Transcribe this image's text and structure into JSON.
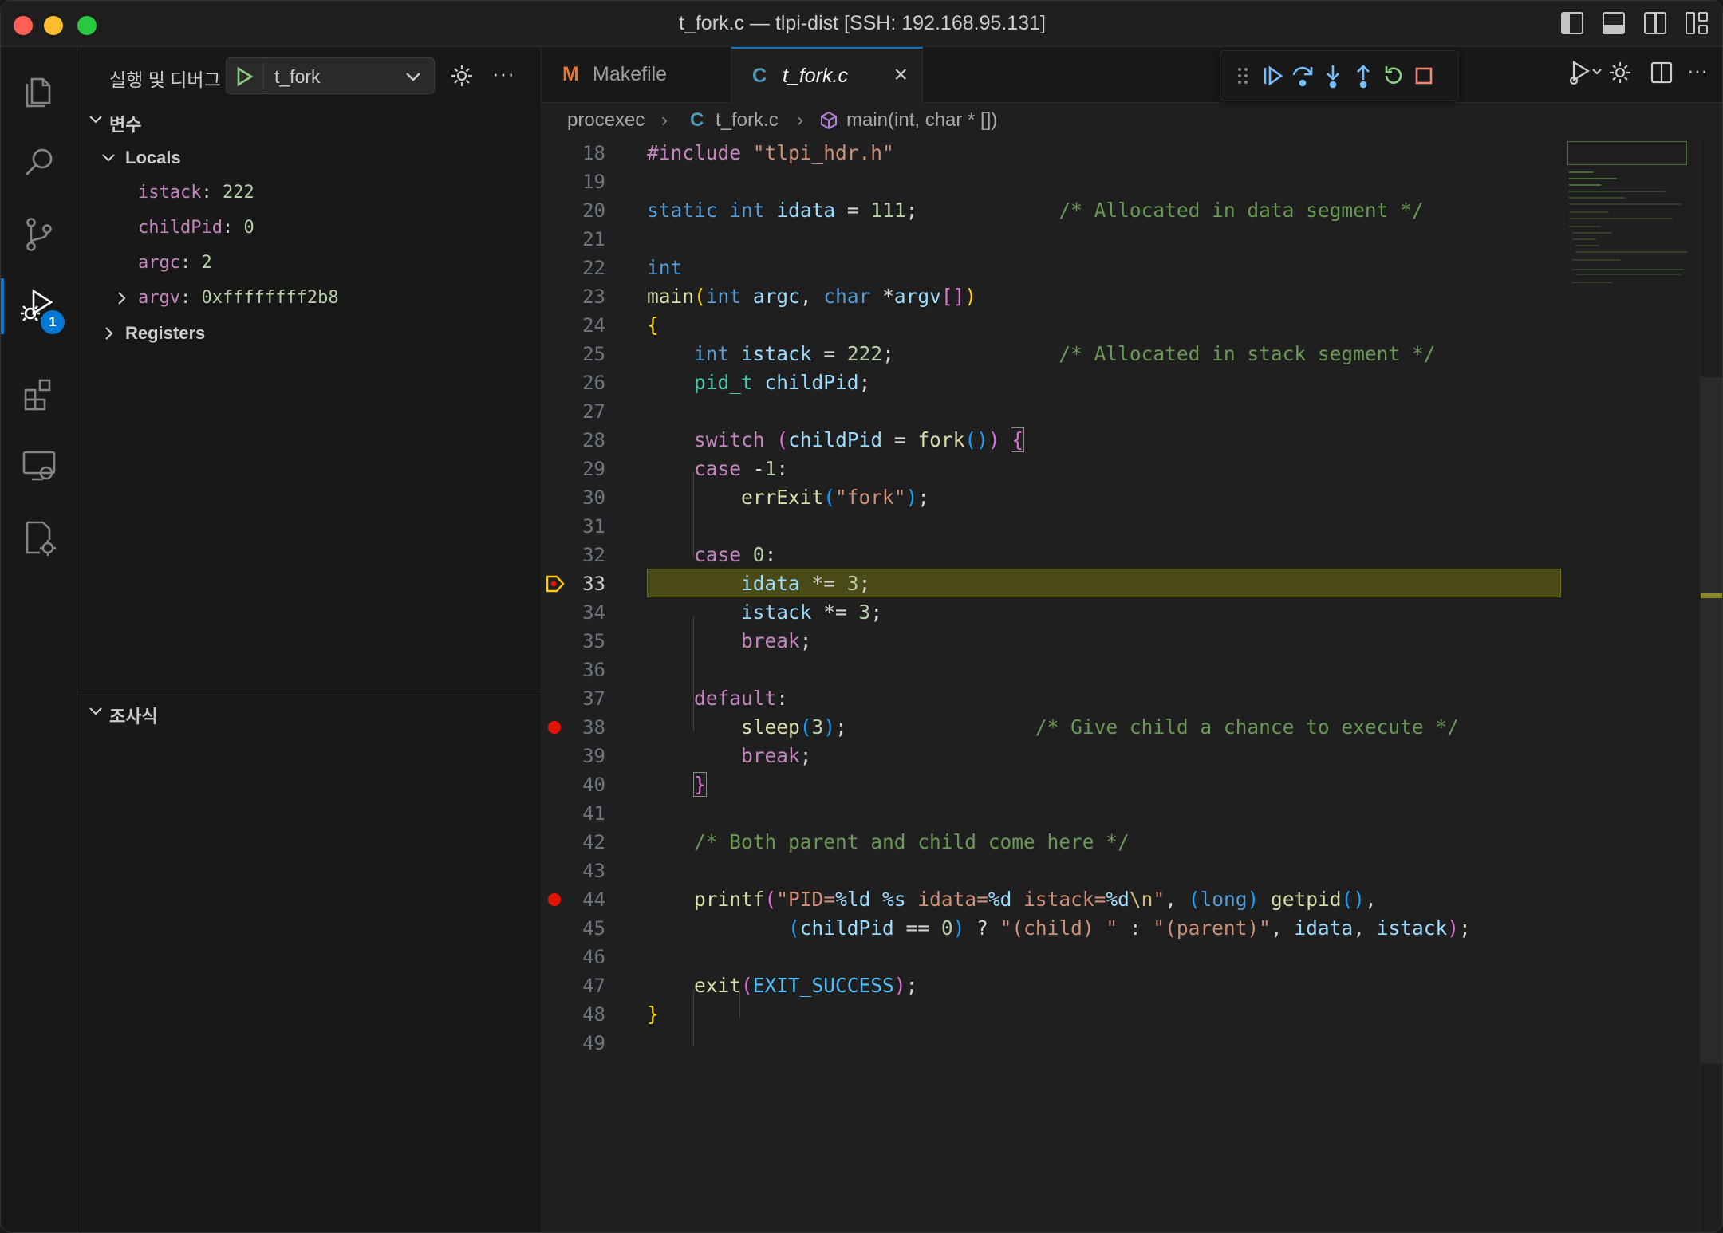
{
  "window": {
    "title": "t_fork.c — tlpi-dist [SSH: 192.168.95.131]"
  },
  "activity_bar": {
    "items": [
      {
        "name": "explorer",
        "icon": "files-icon"
      },
      {
        "name": "search",
        "icon": "search-icon"
      },
      {
        "name": "source-control",
        "icon": "source-control-icon"
      },
      {
        "name": "run-and-debug",
        "icon": "run-debug-icon",
        "badge": "1",
        "active": true
      },
      {
        "name": "extensions",
        "icon": "extensions-icon"
      },
      {
        "name": "remote-explorer",
        "icon": "remote-explorer-icon"
      },
      {
        "name": "remote-settings",
        "icon": "remote-gear-icon"
      }
    ]
  },
  "sidebar": {
    "title": "실행 및 디버그",
    "launch_config": "t_fork",
    "variables_header": "변수",
    "locals_label": "Locals",
    "locals": [
      {
        "name": "istack",
        "value": "222"
      },
      {
        "name": "childPid",
        "value": "0"
      },
      {
        "name": "argc",
        "value": "2"
      },
      {
        "name": "argv",
        "value": "0xffffffff2b8"
      }
    ],
    "registers_label": "Registers",
    "watch_header": "조사식"
  },
  "tabs": [
    {
      "icon_letter": "M",
      "label": "Makefile",
      "active": false
    },
    {
      "icon_letter": "C",
      "label": "t_fork.c",
      "active": true
    }
  ],
  "breadcrumb": {
    "folder": "procexec",
    "file_icon": "C",
    "file": "t_fork.c",
    "symbol": "main(int, char * [])"
  },
  "editor": {
    "current_line": 33,
    "breakpoints": [
      38,
      44
    ],
    "line_numbers": [
      "18",
      "19",
      "20",
      "21",
      "22",
      "23",
      "24",
      "25",
      "26",
      "27",
      "28",
      "29",
      "30",
      "31",
      "32",
      "33",
      "34",
      "35",
      "36",
      "37",
      "38",
      "39",
      "40",
      "41",
      "42",
      "43",
      "44",
      "45",
      "46",
      "47",
      "48",
      "49"
    ]
  },
  "colors": {
    "accent": "#0078d4",
    "breakpoint": "#e51400",
    "current_line_bg": "#4b4b18",
    "current_line_arrow": "#ffcc00"
  }
}
